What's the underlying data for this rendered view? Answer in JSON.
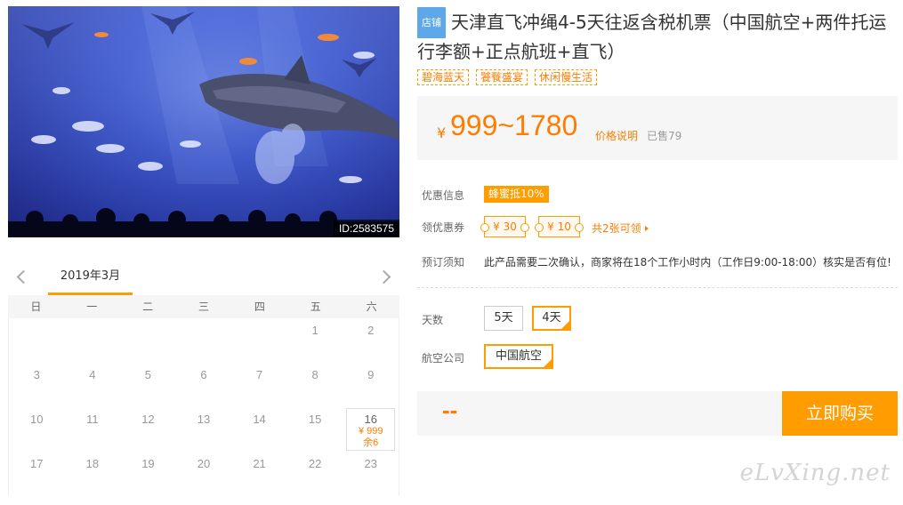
{
  "photo": {
    "id_label": "ID:2583575"
  },
  "calendar": {
    "month": "2019年3月",
    "weekdays": [
      "日",
      "一",
      "二",
      "三",
      "四",
      "五",
      "六"
    ],
    "days": [
      {
        "day": ""
      },
      {
        "day": ""
      },
      {
        "day": ""
      },
      {
        "day": ""
      },
      {
        "day": ""
      },
      {
        "day": "1"
      },
      {
        "day": "2"
      },
      {
        "day": "3"
      },
      {
        "day": "4"
      },
      {
        "day": "5"
      },
      {
        "day": "6"
      },
      {
        "day": "7"
      },
      {
        "day": "8"
      },
      {
        "day": "9"
      },
      {
        "day": "10"
      },
      {
        "day": "11"
      },
      {
        "day": "12"
      },
      {
        "day": "13"
      },
      {
        "day": "14"
      },
      {
        "day": "15"
      },
      {
        "day": "16",
        "price": "¥ 999",
        "stock": "余6"
      },
      {
        "day": "17"
      },
      {
        "day": "18"
      },
      {
        "day": "19"
      },
      {
        "day": "20"
      },
      {
        "day": "21"
      },
      {
        "day": "22"
      },
      {
        "day": "23"
      }
    ]
  },
  "product": {
    "shop_badge": "店铺",
    "title": "天津直飞冲绳4-5天往返含税机票（中国航空+两件托运行李额+正点航班+直飞）",
    "tags": [
      "碧海蓝天",
      "饕餮盛宴",
      "休闲慢生活"
    ]
  },
  "price": {
    "currency": "¥",
    "range": "999~1780",
    "explain": "价格说明",
    "sold": "已售79"
  },
  "promo": {
    "label": "优惠信息",
    "badge": "蜂蜜抵10%"
  },
  "coupons": {
    "label": "领优惠券",
    "items": [
      "¥ 30",
      "¥ 10"
    ],
    "more": "共2张可领"
  },
  "booking": {
    "label": "预订须知",
    "text": "此产品需要二次确认，商家将在18个工作小时内（工作日9:00-18:00）核实是否有位!"
  },
  "options": {
    "days_label": "天数",
    "days": [
      "5天",
      "4天"
    ],
    "airline_label": "航空公司",
    "airline": "中国航空"
  },
  "buy": {
    "total": "--",
    "button": "立即购买"
  },
  "watermark": "eLvXing.net",
  "colors": {
    "accent": "#ff9d00",
    "price": "#ff7c00",
    "badge_blue": "#5ea7e8"
  }
}
